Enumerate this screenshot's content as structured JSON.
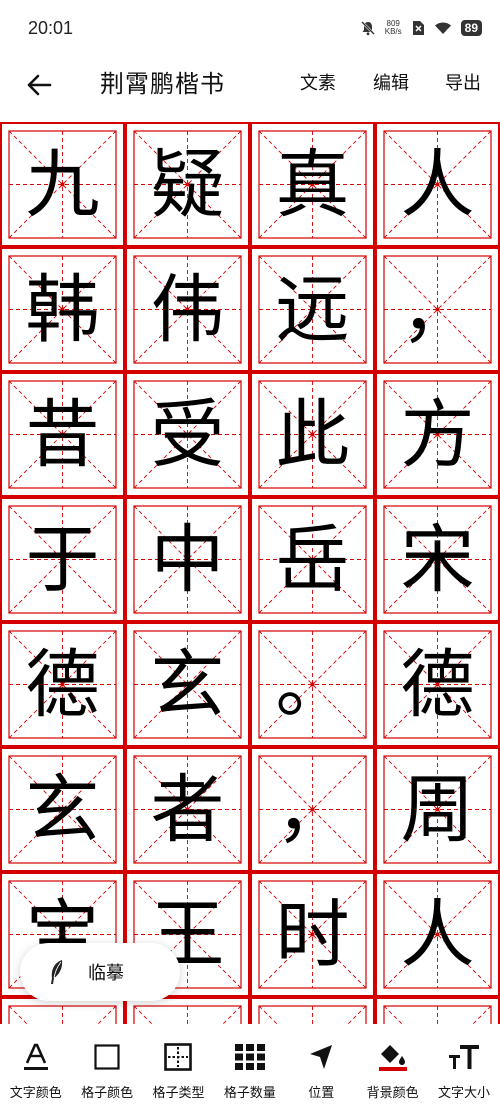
{
  "status": {
    "time": "20:01",
    "net_speed_value": "809",
    "net_speed_unit": "KB/s",
    "battery": "89"
  },
  "appbar": {
    "title": "荆霄鹏楷书",
    "actions": [
      "文素",
      "编辑",
      "导出"
    ]
  },
  "grid": {
    "columns": 4,
    "visible_rows": 8,
    "grid_color": "#d40000",
    "guide_color": "#d40000",
    "characters": [
      "九",
      "疑",
      "真",
      "人",
      "韩",
      "伟",
      "远",
      "，",
      "昔",
      "受",
      "此",
      "方",
      "于",
      "中",
      "岳",
      "宋",
      "德",
      "玄",
      "。",
      "德",
      "玄",
      "者",
      "，",
      "周",
      "宝",
      "王",
      "时",
      "人",
      "",
      "",
      "",
      ""
    ]
  },
  "trace_button": {
    "label": "临摹",
    "icon": "feather-icon"
  },
  "toolbar": {
    "items": [
      {
        "label": "文字颜色",
        "icon": "text-color-icon"
      },
      {
        "label": "格子颜色",
        "icon": "grid-color-icon"
      },
      {
        "label": "格子类型",
        "icon": "grid-type-icon"
      },
      {
        "label": "格子数量",
        "icon": "grid-count-icon"
      },
      {
        "label": "位置",
        "icon": "position-icon"
      },
      {
        "label": "背景颜色",
        "icon": "background-color-icon"
      },
      {
        "label": "文字大小",
        "icon": "text-size-icon"
      }
    ]
  }
}
